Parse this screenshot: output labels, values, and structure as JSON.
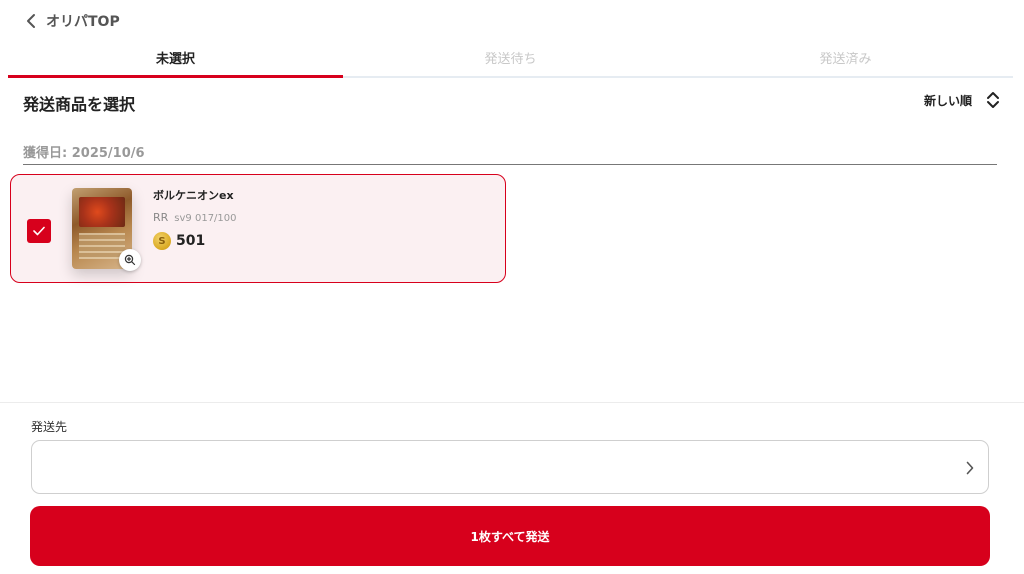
{
  "nav": {
    "back_label": "オリパTOP"
  },
  "tabs": [
    {
      "label": "未選択",
      "active": true
    },
    {
      "label": "発送待ち",
      "active": false
    },
    {
      "label": "発送済み",
      "active": false
    }
  ],
  "section": {
    "title": "発送商品を選択",
    "sort_label": "新しい順"
  },
  "group": {
    "date_label": "獲得日: 2025/10/6"
  },
  "items": [
    {
      "name": "ボルケニオンex",
      "rarity": "RR",
      "set_number": "sv9 017/100",
      "price": "501",
      "selected": true
    }
  ],
  "destination": {
    "label": "発送先",
    "value": ""
  },
  "action": {
    "ship_label": "1枚すべて発送"
  },
  "colors": {
    "accent": "#d7001c",
    "selected_bg": "#fbf0f2",
    "inactive_tab": "#c8c8c8"
  }
}
